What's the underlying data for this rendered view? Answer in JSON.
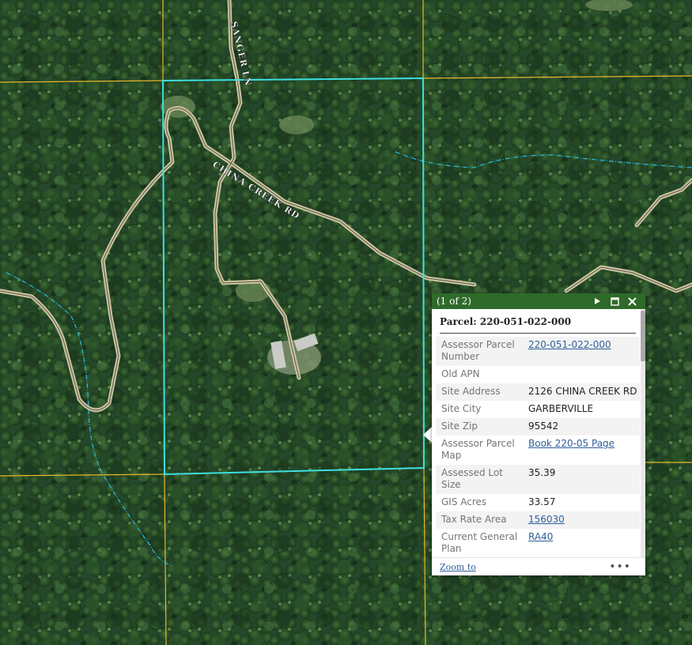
{
  "map": {
    "road_labels": [
      "SANGER LN",
      "CHINA CREEK RD"
    ],
    "colors": {
      "parcel_highlight": "#3ee0e0",
      "parcel_lines": "#e8b62a",
      "road_casing": "#d6cfae",
      "stream": "#29b6d6",
      "forest": "#28502a"
    }
  },
  "popup": {
    "count": "(1 of 2)",
    "title": "Parcel: 220-051-022-000",
    "icons": [
      "next-icon",
      "maximize-icon",
      "close-icon"
    ],
    "fields": [
      {
        "key": "Assessor Parcel Number",
        "value": "220-051-022-000",
        "link": true
      },
      {
        "key": "Old APN",
        "value": "",
        "link": false
      },
      {
        "key": "Site Address",
        "value": "2126 CHINA CREEK RD",
        "link": false
      },
      {
        "key": "Site City",
        "value": "GARBERVILLE",
        "link": false
      },
      {
        "key": "Site Zip",
        "value": "95542",
        "link": false
      },
      {
        "key": "Assessor Parcel Map",
        "value": "Book 220-05 Page",
        "link": true
      },
      {
        "key": "Assessed Lot Size",
        "value": "35.39",
        "link": false
      },
      {
        "key": "GIS Acres",
        "value": "33.57",
        "link": false
      },
      {
        "key": "Tax Rate Area",
        "value": "156030",
        "link": true
      },
      {
        "key": "Current General Plan",
        "value": "RA40",
        "link": true
      }
    ],
    "footer": {
      "zoom_label": "Zoom to",
      "more_label": "•••"
    },
    "header_color": "#2f6a2a"
  }
}
